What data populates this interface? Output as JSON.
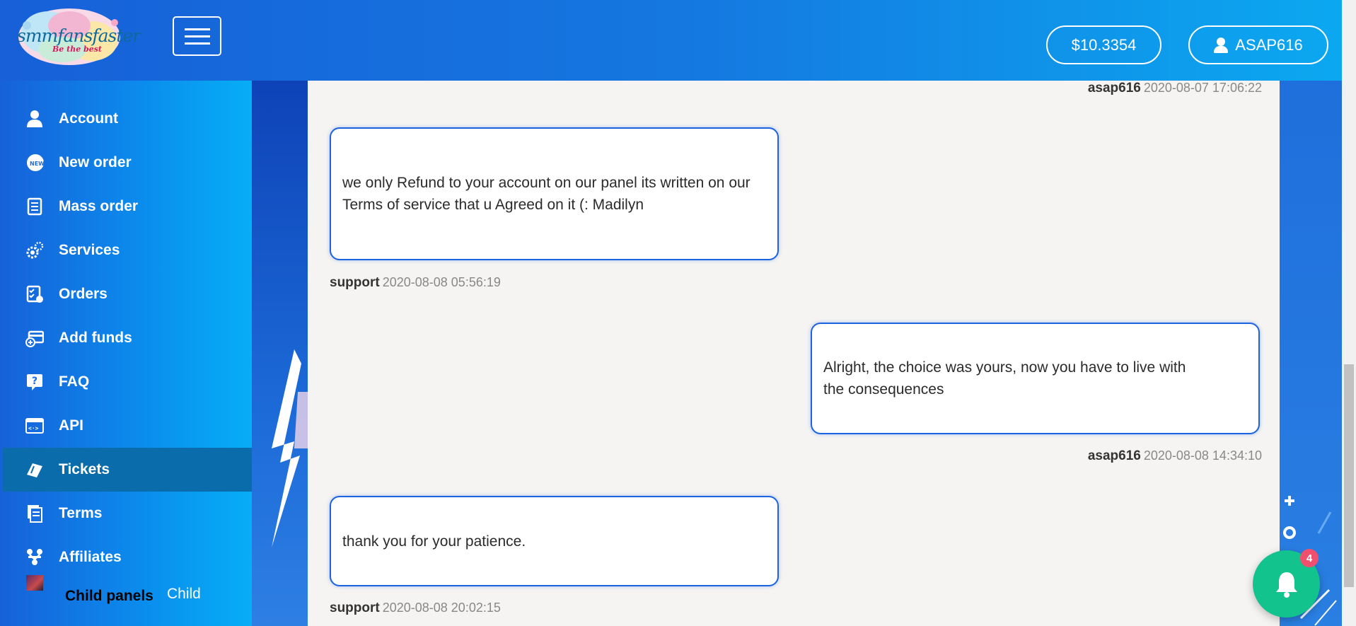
{
  "header": {
    "logo_text": "smmfansfaster",
    "logo_tagline": "Be the best",
    "balance": "$10.3354",
    "username": "ASAP616"
  },
  "sidebar": {
    "items": [
      {
        "label": "Account",
        "icon": "user-icon"
      },
      {
        "label": "New order",
        "icon": "new-badge-icon"
      },
      {
        "label": "Mass order",
        "icon": "list-document-icon"
      },
      {
        "label": "Services",
        "icon": "gears-icon"
      },
      {
        "label": "Orders",
        "icon": "checklist-icon"
      },
      {
        "label": "Add funds",
        "icon": "wallet-plus-icon"
      },
      {
        "label": "FAQ",
        "icon": "question-icon"
      },
      {
        "label": "API",
        "icon": "code-window-icon"
      },
      {
        "label": "Tickets",
        "icon": "ticket-icon",
        "active": true
      },
      {
        "label": "Terms",
        "icon": "document-stack-icon"
      },
      {
        "label": "Affiliates",
        "icon": "people-network-icon"
      }
    ],
    "child_panels_label": "Child panels",
    "child_panels_label2": "Child"
  },
  "messages": [
    {
      "author": "asap616",
      "time": "2020-08-07 17:06:22",
      "side": "right",
      "text": ""
    },
    {
      "author": "support",
      "time": "2020-08-08 05:56:19",
      "side": "left",
      "text": "we only Refund to your account on our panel its written on our Terms of service that u Agreed on it (: Madilyn"
    },
    {
      "author": "asap616",
      "time": "2020-08-08 14:34:10",
      "side": "right",
      "text": "Alright, the choice was yours, now you have to live with the consequences"
    },
    {
      "author": "support",
      "time": "2020-08-08 20:02:15",
      "side": "left",
      "text": "thank you for your patience."
    }
  ],
  "notifications": {
    "count": "4"
  },
  "colors": {
    "accent": "#1b63e0",
    "active_nav": "#0a6cab",
    "notif": "#13c38d",
    "badge": "#f0506e"
  }
}
